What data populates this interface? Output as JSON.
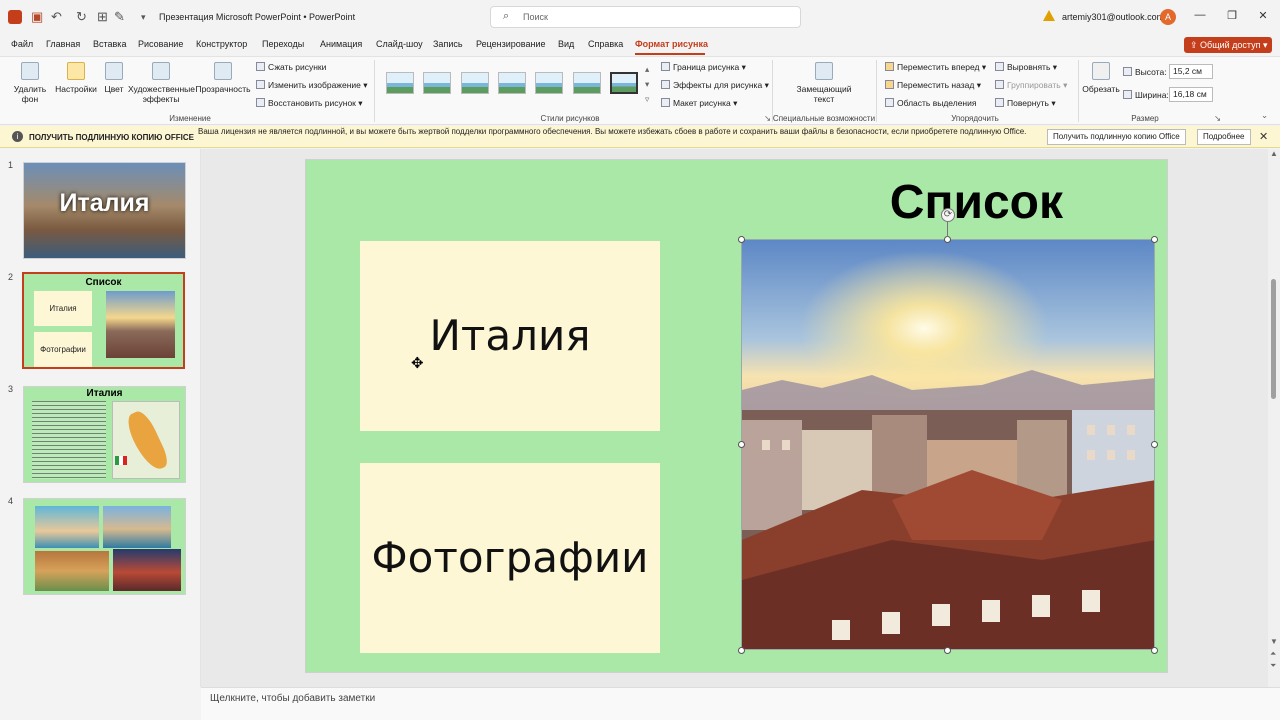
{
  "titlebar": {
    "doc_title": "Презентация Microsoft PowerPoint  •  PowerPoint",
    "search_placeholder": "Поиск",
    "account": "artemiy301@outlook.com",
    "avatar_letter": "A"
  },
  "tabs": [
    "Файл",
    "Главная",
    "Вставка",
    "Рисование",
    "Конструктор",
    "Переходы",
    "Анимация",
    "Слайд-шоу",
    "Запись",
    "Рецензирование",
    "Вид",
    "Справка",
    "Формат рисунка"
  ],
  "share_label": "Общий доступ",
  "ribbon": {
    "remove_bg": "Удалить фон",
    "corrections": "Настройки",
    "color": "Цвет",
    "artistic": "Художественные эффекты",
    "transparency": "Прозрачность",
    "compress": "Сжать рисунки",
    "change": "Изменить изображение",
    "reset": "Восстановить рисунок",
    "group_change": "Изменение",
    "group_styles": "Стили рисунков",
    "border": "Граница рисунка",
    "effects": "Эффекты для рисунка",
    "layout": "Макет рисунка",
    "alt_text": "Замещающий текст",
    "group_access": "Специальные возможности",
    "forward": "Переместить вперед",
    "backward": "Переместить назад",
    "selection_pane": "Область выделения",
    "align": "Выровнять",
    "group_btn": "Группировать",
    "rotate": "Повернуть",
    "group_arrange": "Упорядочить",
    "crop": "Обрезать",
    "height_label": "Высота:",
    "height_value": "15,2 см",
    "width_label": "Ширина:",
    "width_value": "16,18 см",
    "group_size": "Размер"
  },
  "infobar": {
    "title": "ПОЛУЧИТЬ ПОДЛИННУЮ КОПИЮ OFFICE",
    "message": "Ваша лицензия не является подлинной, и вы можете быть жертвой подделки программного обеспечения. Вы можете избежать сбоев в работе и сохранить ваши файлы в безопасности, если приобретете подлинную Office.",
    "btn_get": "Получить подлинную копию Office",
    "btn_more": "Подробнее"
  },
  "thumbnails": [
    {
      "num": "1",
      "title": "Италия"
    },
    {
      "num": "2",
      "title": "Список",
      "item1": "Италия",
      "item2": "Фотографии"
    },
    {
      "num": "3",
      "title": "Италия"
    },
    {
      "num": "4"
    }
  ],
  "slide": {
    "title": "Список",
    "card1": "Италия",
    "card2": "Фотографии"
  },
  "notes_placeholder": "Щелкните, чтобы добавить заметки",
  "colors": {
    "accent": "#c43e1c",
    "slide_bg": "#a9e8a6",
    "card_bg": "#fdf7d6"
  }
}
